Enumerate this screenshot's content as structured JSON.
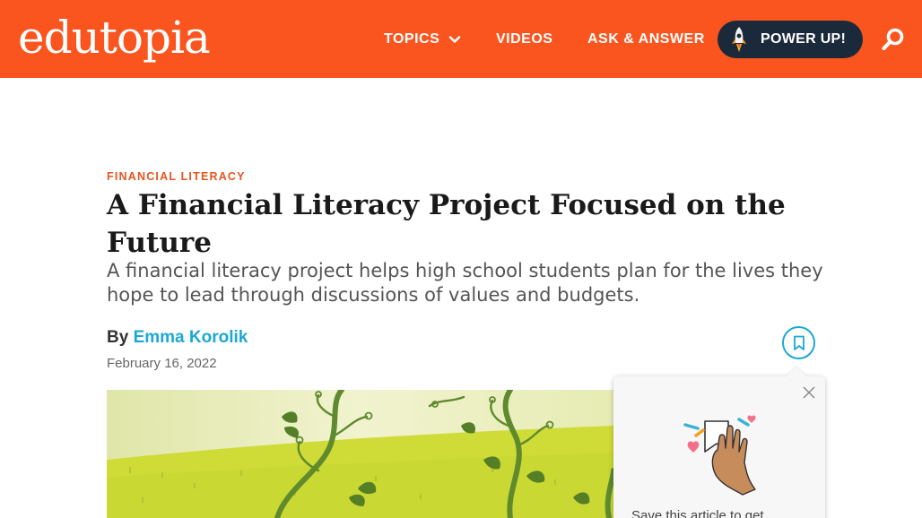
{
  "header": {
    "logo": "edutopia",
    "nav": {
      "topics": "TOPICS",
      "videos": "VIDEOS",
      "ask_answer": "ASK & ANSWER"
    },
    "power_up": "POWER UP!",
    "brand_color": "#fa551e",
    "button_color": "#1b2a3a",
    "icons": {
      "topics_menu": "chevron-down-icon",
      "power_up": "rocket-icon",
      "search": "search-icon"
    }
  },
  "article": {
    "category": "FINANCIAL LITERACY",
    "title": "A Financial Literacy Project Focused on the Future",
    "deck": "A financial literacy project helps high school students plan for the lives they hope to lead through discussions of values and budgets.",
    "byline_prefix": "By",
    "author": "Emma Korolik",
    "date": "February 16, 2022",
    "accent_color": "#1ba8d4",
    "category_color": "#e8541e"
  },
  "save_popover": {
    "message": "Save this article to get",
    "icons": {
      "close": "close-icon",
      "illustration": "waving-hand-illustration",
      "save": "bookmark-icon"
    }
  }
}
